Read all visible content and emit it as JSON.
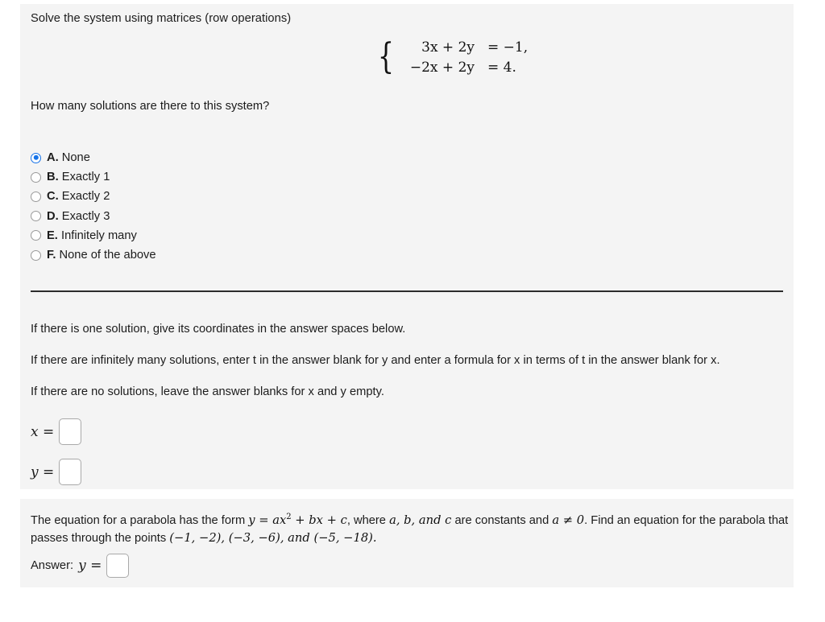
{
  "problem_one": {
    "title": "Solve the system using matrices (row operations)",
    "system": {
      "equations": [
        {
          "lhs": "3x + 2y",
          "rhs": "= −1,"
        },
        {
          "lhs": "−2x + 2y",
          "rhs": "= 4."
        }
      ]
    },
    "question": "How many solutions are there to this system?",
    "choices": [
      {
        "key": "A.",
        "label": "None",
        "selected": true
      },
      {
        "key": "B.",
        "label": "Exactly 1",
        "selected": false
      },
      {
        "key": "C.",
        "label": "Exactly 2",
        "selected": false
      },
      {
        "key": "D.",
        "label": "Exactly 3",
        "selected": false
      },
      {
        "key": "E.",
        "label": "Infinitely many",
        "selected": false
      },
      {
        "key": "F.",
        "label": "None of the above",
        "selected": false
      }
    ],
    "instructions": [
      "If there is one solution, give its coordinates in the answer spaces below.",
      "If there are infinitely many solutions, enter t in the answer blank for y and enter a formula for x in terms of t in the answer blank for x.",
      "If there are no solutions, leave the answer blanks for x and y empty."
    ],
    "answers": [
      {
        "var": "x",
        "eq": "=",
        "value": "",
        "placeholder": ""
      },
      {
        "var": "y",
        "eq": "=",
        "value": "",
        "placeholder": ""
      }
    ]
  },
  "problem_two": {
    "text_part1": "The equation for a parabola has the form ",
    "form": "y = ax",
    "form_exp": "2",
    "form_rest": " + bx + c",
    "text_part2": ", where ",
    "constants": "a, b, and c",
    "text_part3": " are constants and ",
    "condition": "a ≠ 0",
    "text_part4": ". Find an equation for the parabola that passes through the points ",
    "points": "(−1, −2), (−3, −6), and (−5, −18).",
    "answer_label": "Answer:",
    "answer_var": "y",
    "answer_eq": "=",
    "answer_value": "",
    "answer_placeholder": ""
  },
  "colors": {
    "panel_background": "#f4f4f4",
    "page_background": "#ffffff",
    "radio_selected": "#1673e8",
    "text": "#1c1c1c",
    "divider": "#2b2b2b",
    "input_border": "#a9a9a9"
  }
}
